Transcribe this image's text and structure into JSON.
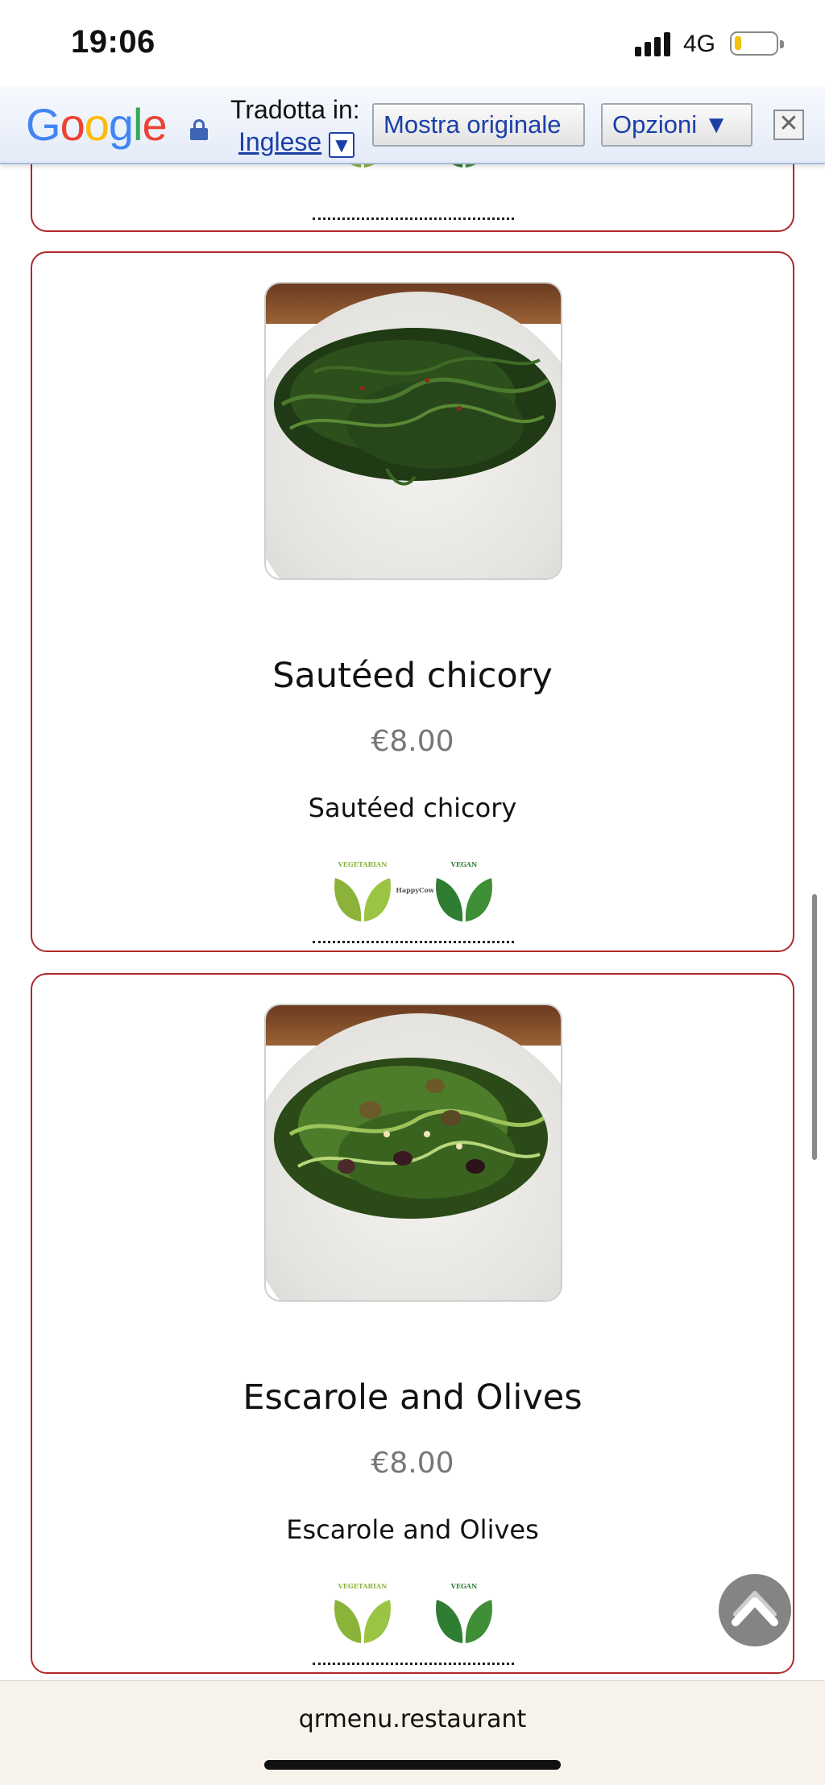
{
  "status_bar": {
    "time": "19:06",
    "network": "4G"
  },
  "translate_bar": {
    "logo_text": "Google",
    "label": "Tradotta in:",
    "language": "Inglese",
    "dropdown_glyph": "▼",
    "show_original": "Mostra originale",
    "options": "Opzioni ▼",
    "close_glyph": "✕"
  },
  "badges": {
    "vegetarian": "VEGETARIAN",
    "vegan": "VEGAN",
    "happycow": "HappyCow",
    "vegetarian_color": "#8bb33a",
    "vegan_color": "#2f7d32"
  },
  "dishes": [
    {
      "name": "Sautéed chicory",
      "price": "€8.00",
      "description": "Sautéed chicory"
    },
    {
      "name": "Escarole and Olives",
      "price": "€8.00",
      "description": "Escarole and Olives"
    }
  ],
  "footer": {
    "url": "qrmenu.restaurant"
  },
  "colors": {
    "card_border": "#b0282a",
    "price": "#777777"
  }
}
